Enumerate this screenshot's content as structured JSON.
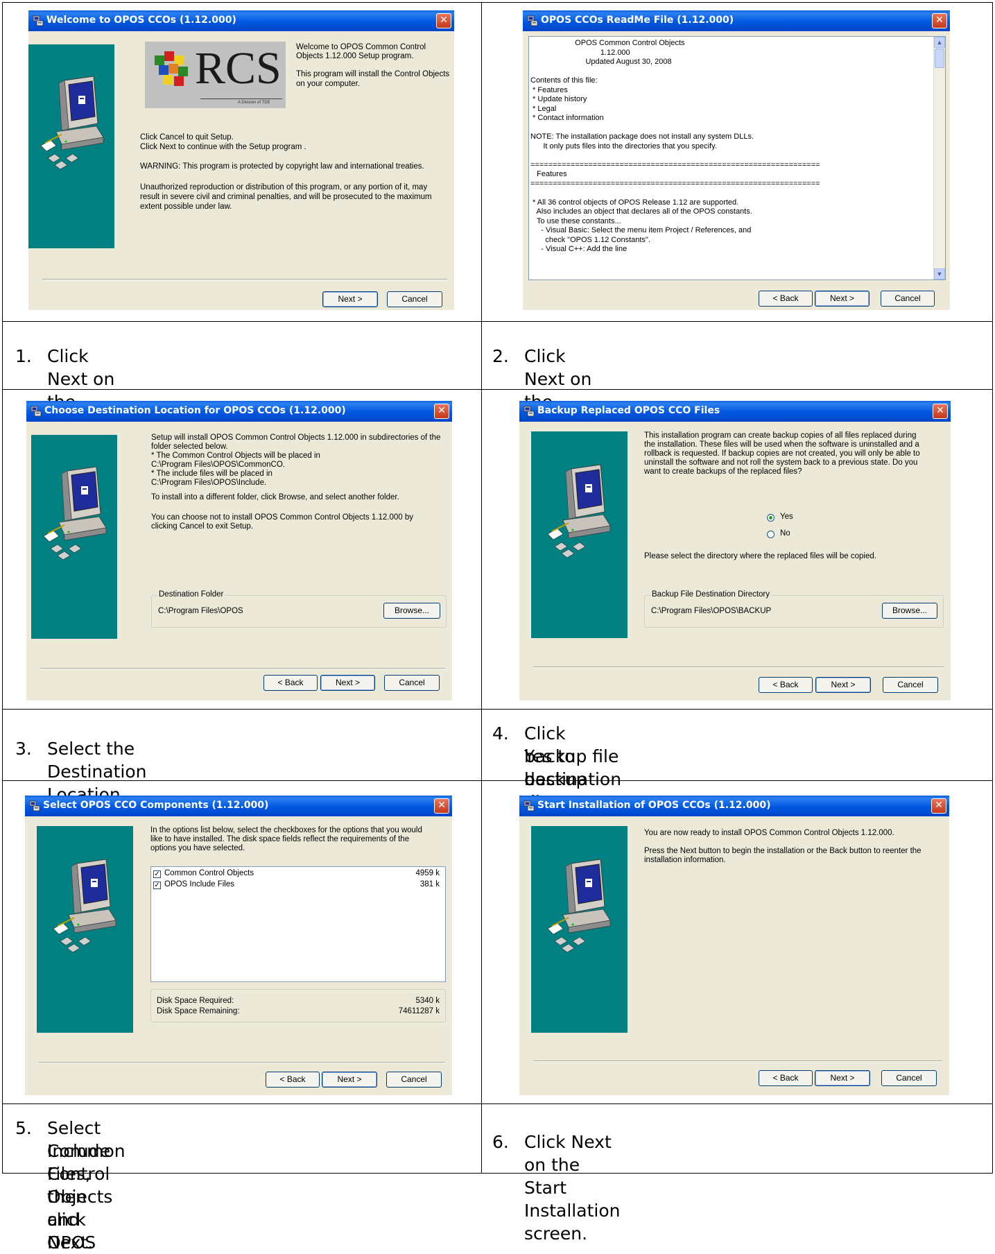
{
  "dialogs": {
    "welcome": {
      "title": "Welcome to OPOS CCOs (1.12.000)",
      "logo_text": "RCS",
      "logo_subtext": "A Division of TDE",
      "intro1": "Welcome to OPOS Common Control",
      "intro2": "Objects 1.12.000 Setup program.",
      "intro3": "This program will install the Control Objects",
      "intro4": "on your computer.",
      "line1": "Click Cancel to quit Setup.",
      "line2": "Click Next to continue with the Setup program .",
      "warning": "WARNING: This program is protected by copyright law and international treaties.",
      "legal1": "Unauthorized reproduction or distribution of this program, or any portion of it, may",
      "legal2": "result in severe civil and criminal penalties, and will be prosecuted to the maximum",
      "legal3": "extent possible under law.",
      "next": "Next >",
      "cancel": "Cancel"
    },
    "readme": {
      "title": "OPOS CCOs ReadMe File (1.12.000)",
      "lines": [
        "                     OPOS Common Control Objects",
        "                                 1.12.000",
        "                          Updated August 30, 2008",
        "",
        "Contents of this file:",
        " * Features",
        " * Update history",
        " * Legal",
        " * Contact information",
        "",
        "NOTE: The installation package does not install any system DLLs.",
        "      It only puts files into the directories that you specify.",
        "",
        "=================================================================",
        "   Features",
        "=================================================================",
        "",
        " * All 36 control objects of OPOS Release 1.12 are supported.",
        "   Also includes an object that declares all of the OPOS constants.",
        "   To use these constants...",
        "     - Visual Basic: Select the menu item Project / References, and",
        "       check \"OPOS 1.12 Constants\".",
        "     - Visual C++: Add the line"
      ],
      "back": "< Back",
      "next": "Next >",
      "cancel": "Cancel"
    },
    "destination": {
      "title": "Choose Destination Location for OPOS CCOs (1.12.000)",
      "p1": "Setup will install OPOS Common Control Objects 1.12.000 in subdirectories of the",
      "p2": "folder selected below.",
      "p3": " * The Common Control Objects will be placed in",
      "p4": "     C:\\Program Files\\OPOS\\CommonCO.",
      "p5": " * The include files will be placed in",
      "p6": "     C:\\Program Files\\OPOS\\Include.",
      "p7": "To install into a different folder, click Browse, and select another folder.",
      "p8": "You can choose not to install OPOS Common Control Objects 1.12.000 by",
      "p9": "clicking Cancel to exit Setup.",
      "group_label": "Destination Folder",
      "path": "C:\\Program Files\\OPOS",
      "browse": "Browse...",
      "back": "< Back",
      "next": "Next >",
      "cancel": "Cancel"
    },
    "backup": {
      "title": "Backup Replaced OPOS CCO Files",
      "p1": "This installation program can create backup copies of all files replaced during",
      "p2": "the installation. These files will be used when the software is uninstalled and a",
      "p3": "rollback is requested.  If backup copies are not created, you will only be able to",
      "p4": "uninstall the software and not roll the system back to a previous state.  Do you",
      "p5": "want to create backups of the replaced files?",
      "yes": "Yes",
      "no": "No",
      "selected": "Yes",
      "p6": "Please select the directory where the replaced  files will be copied.",
      "group_label": "Backup File Destination Directory",
      "path": "C:\\Program Files\\OPOS\\BACKUP",
      "browse": "Browse...",
      "back": "< Back",
      "next": "Next >",
      "cancel": "Cancel"
    },
    "components": {
      "title": "Select OPOS CCO Components (1.12.000)",
      "p1": "In the options list below, select the checkboxes for the options that you would",
      "p2": "like to have installed.  The disk space fields reflect the requirements of the",
      "p3": "options you have selected.",
      "items": [
        {
          "name": "Common Control Objects",
          "size": "4959 k",
          "checked": true
        },
        {
          "name": "OPOS Include Files",
          "size": "381 k",
          "checked": true
        }
      ],
      "required_label": "Disk Space Required:",
      "required_value": "5340 k",
      "remaining_label": "Disk Space Remaining:",
      "remaining_value": "74611287 k",
      "back": "< Back",
      "next": "Next >",
      "cancel": "Cancel"
    },
    "start": {
      "title": "Start Installation of OPOS CCOs (1.12.000)",
      "p1": "You are now ready to install OPOS Common Control Objects 1.12.000.",
      "p2": "Press the Next button to begin the installation or the Back button to reenter the",
      "p3": "installation information.",
      "back": "< Back",
      "next": "Next >",
      "cancel": "Cancel"
    }
  },
  "captions": [
    {
      "num": "1.",
      "lines": [
        "Click Next on the Welcome screen."
      ]
    },
    {
      "num": "2.",
      "lines": [
        "Click Next on the ReadMe screen."
      ]
    },
    {
      "num": "3.",
      "lines": [
        "Select the Destination Location and click Next."
      ]
    },
    {
      "num": "4.",
      "lines": [
        "Click Yes to backup the CCO files and select",
        "backup file destination directory, then click Next."
      ]
    },
    {
      "num": "5.",
      "lines": [
        "Select Common Control Objects and OPOS",
        "Include Files, then click Next."
      ]
    },
    {
      "num": "6.",
      "lines": [
        "Click Next on the Start Installation screen."
      ]
    }
  ],
  "colors": {
    "title_bar": "#0058e0",
    "dialog_bg": "#ece9d8",
    "side_panel": "#008080",
    "close_button": "#c3391a"
  },
  "icons": [
    "setup-icon",
    "close-icon",
    "computer-icon",
    "disk-icon",
    "scroll-up-icon",
    "scroll-down-icon"
  ]
}
